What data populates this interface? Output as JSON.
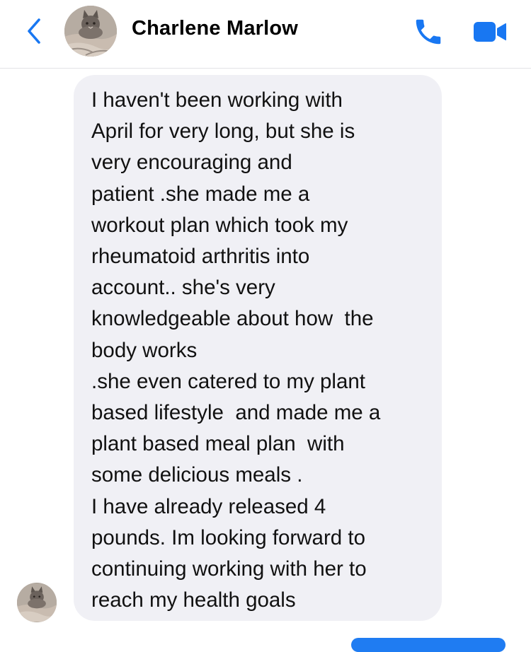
{
  "header": {
    "contact_name": "Charlene Marlow",
    "back_icon": "chevron-left-icon",
    "call_icon": "phone-icon",
    "video_icon": "video-camera-icon",
    "accent_color": "#1877F2"
  },
  "message": {
    "lines": [
      "I haven't been working with",
      "April for very long, but she is",
      "very encouraging and",
      "patient .she made me a",
      "workout plan which took my",
      "rheumatoid arthritis into",
      "account.. she's very",
      "knowledgeable about how  the",
      "body works",
      ".she even catered to my plant",
      "based lifestyle  and made me a",
      "plant based meal plan  with",
      "some delicious meals .",
      "I have already released 4",
      "pounds. Im looking forward to",
      "continuing working with her to",
      "reach my health goals"
    ],
    "bubble_color": "#F0F0F5"
  }
}
